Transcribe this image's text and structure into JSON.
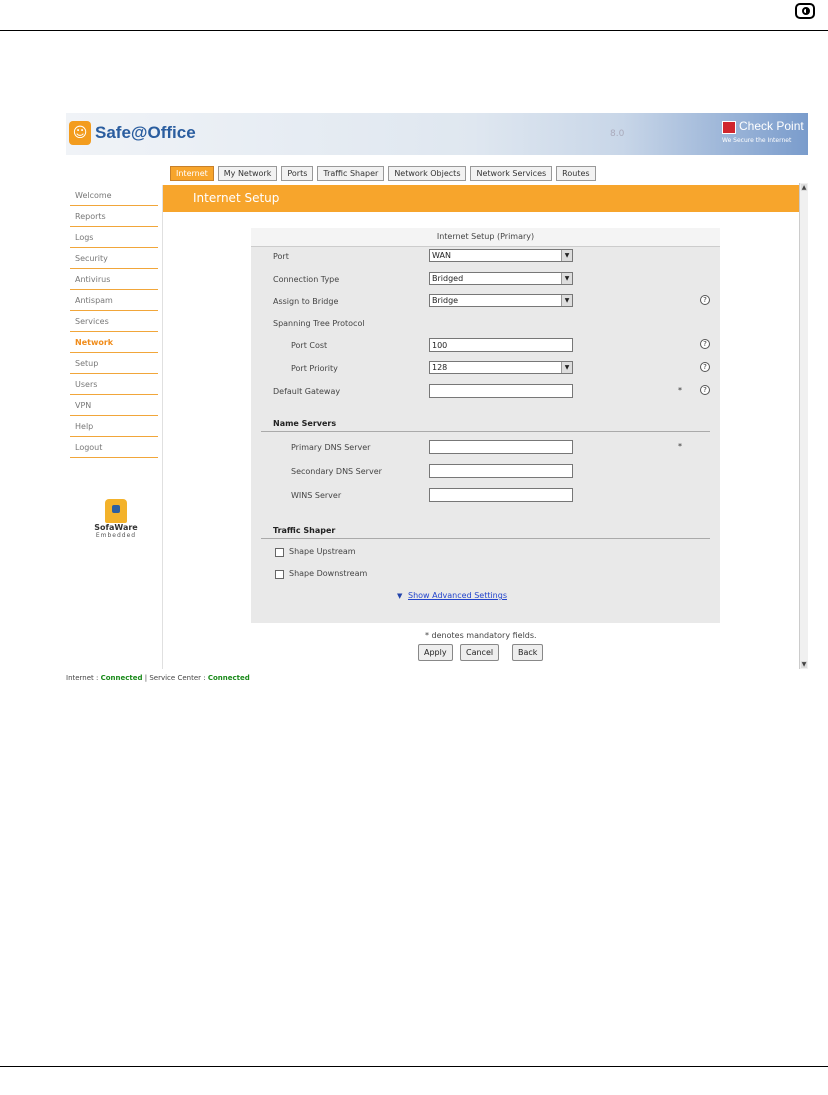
{
  "header": {
    "logo_text": "Safe@Office",
    "version": "8.0",
    "brand": "Check Point",
    "brand_tagline": "We Secure the Internet"
  },
  "tabs": [
    {
      "label": "Internet",
      "active": true
    },
    {
      "label": "My Network",
      "active": false
    },
    {
      "label": "Ports",
      "active": false
    },
    {
      "label": "Traffic Shaper",
      "active": false
    },
    {
      "label": "Network Objects",
      "active": false
    },
    {
      "label": "Network Services",
      "active": false
    },
    {
      "label": "Routes",
      "active": false
    }
  ],
  "sidebar": {
    "items": [
      {
        "label": "Welcome"
      },
      {
        "label": "Reports"
      },
      {
        "label": "Logs"
      },
      {
        "label": "Security"
      },
      {
        "label": "Antivirus"
      },
      {
        "label": "Antispam"
      },
      {
        "label": "Services"
      },
      {
        "label": "Network",
        "active": true
      },
      {
        "label": "Setup"
      },
      {
        "label": "Users"
      },
      {
        "label": "VPN"
      },
      {
        "label": "Help"
      },
      {
        "label": "Logout"
      }
    ],
    "sofaware_name": "SofaWare",
    "sofaware_sub": "Embedded"
  },
  "page": {
    "banner": "Internet Setup",
    "panel_title": "Internet Setup (Primary)"
  },
  "form": {
    "port_label": "Port",
    "port_value": "WAN",
    "conn_type_label": "Connection Type",
    "conn_type_value": "Bridged",
    "assign_bridge_label": "Assign to Bridge",
    "assign_bridge_value": "Bridge",
    "stp_label": "Spanning Tree Protocol",
    "port_cost_label": "Port Cost",
    "port_cost_value": "100",
    "port_priority_label": "Port Priority",
    "port_priority_value": "128",
    "default_gw_label": "Default Gateway",
    "default_gw_value": "",
    "name_servers_heading": "Name Servers",
    "primary_dns_label": "Primary DNS Server",
    "primary_dns_value": "",
    "secondary_dns_label": "Secondary DNS Server",
    "secondary_dns_value": "",
    "wins_label": "WINS Server",
    "wins_value": "",
    "traffic_shaper_heading": "Traffic Shaper",
    "shape_up_label": "Shape Upstream",
    "shape_down_label": "Shape Downstream",
    "advanced_link": "Show Advanced Settings",
    "help_glyph": "?",
    "required_mark": "*"
  },
  "footer_note": "* denotes mandatory fields.",
  "buttons": {
    "apply": "Apply",
    "cancel": "Cancel",
    "back": "Back"
  },
  "status": {
    "internet_label": "Internet : ",
    "internet_value": "Connected",
    "separator": " | ",
    "service_label": "Service Center : ",
    "service_value": "Connected"
  },
  "colors": {
    "accent_orange": "#f7a52c",
    "status_green": "#1a8a1a",
    "link_blue": "#2244cc"
  }
}
